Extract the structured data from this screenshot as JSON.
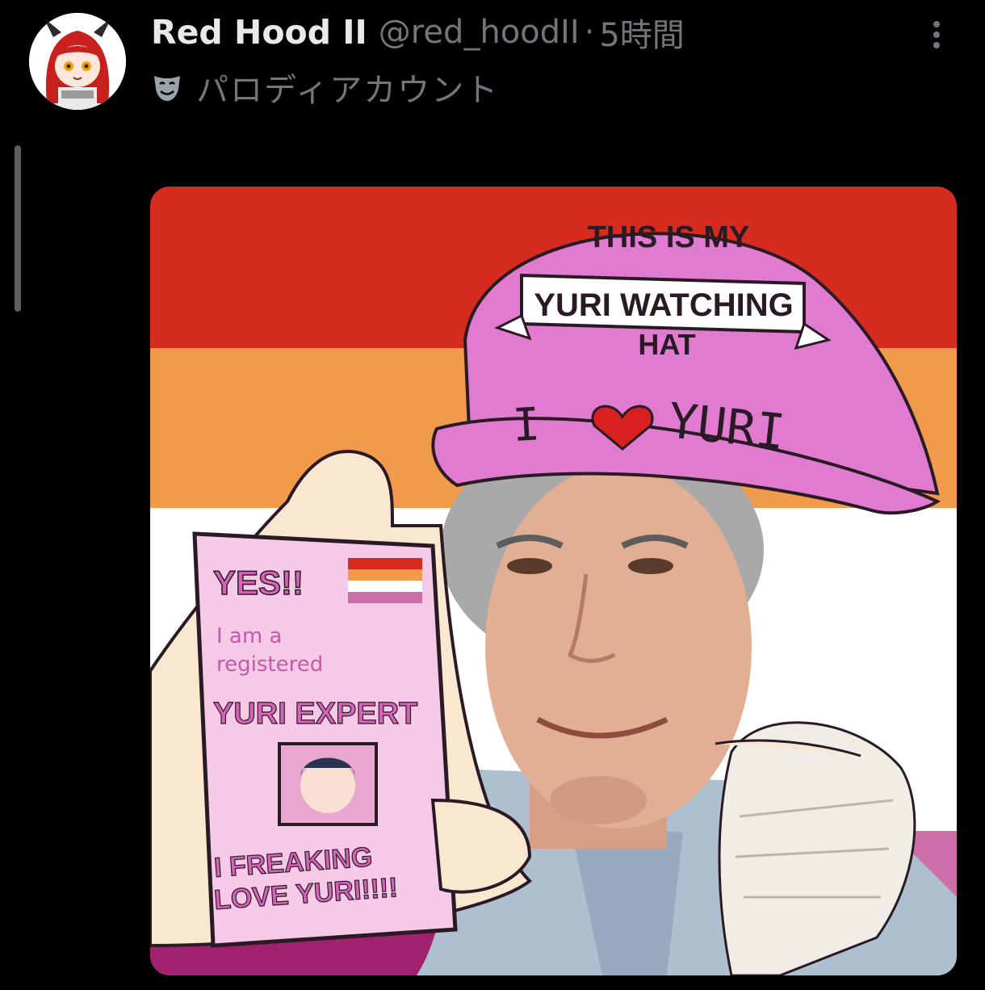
{
  "post": {
    "display_name": "Red Hood II",
    "handle": "@red_hoodII",
    "separator": "·",
    "time": "5時間",
    "account_label": "パロディアカウント",
    "account_label_icon": "theater-mask-icon",
    "more_icon": "more-vertical-icon",
    "avatar_icon": "red-haired-anime-girl-avatar"
  },
  "image": {
    "hat_line1": "THIS IS MY",
    "hat_banner": "YURI WATCHING",
    "hat_line3": "HAT",
    "hat_brim": "YURI",
    "hat_brim_prefix": "I",
    "card_yes": "YES!!",
    "card_line1": "I am a",
    "card_line2": "registered",
    "card_title": "YURI EXPERT",
    "card_footer1": "I FREAKING",
    "card_footer2": "LOVE YURI!!!!",
    "flag_colors": [
      "#d62c1f",
      "#f09a4c",
      "#ffffff",
      "#cc6fa8",
      "#a0226f"
    ],
    "hat_color": "#e07bd0",
    "card_color": "#f6c9e6"
  }
}
